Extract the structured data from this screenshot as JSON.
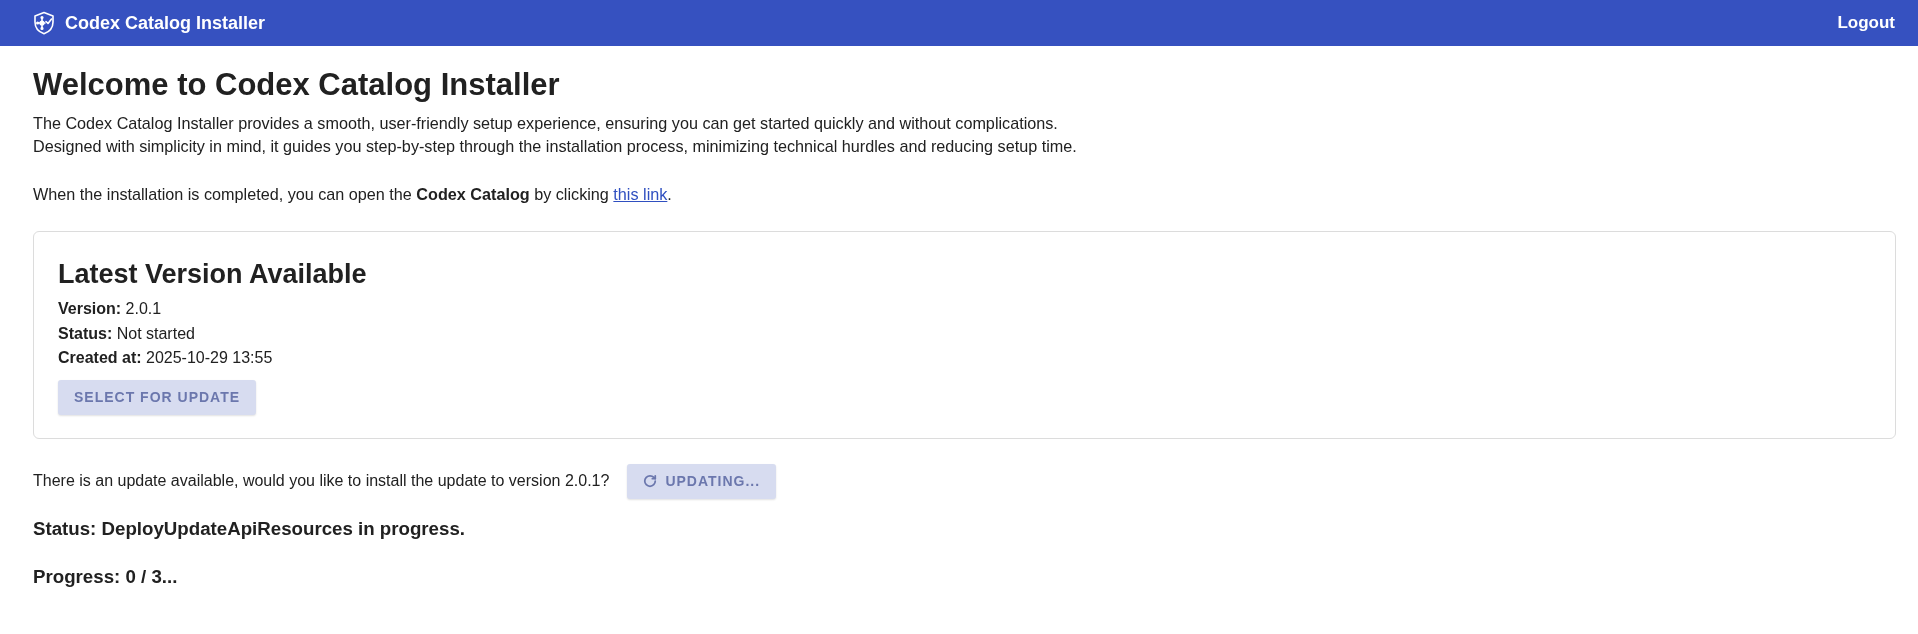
{
  "header": {
    "title": "Codex Catalog Installer",
    "logout": "Logout"
  },
  "intro": {
    "heading": "Welcome to Codex Catalog Installer",
    "lines": [
      "The Codex Catalog Installer provides a smooth, user-friendly setup experience, ensuring you can get started quickly and without complications.",
      "Designed with simplicity in mind, it guides you step-by-step through the installation process, minimizing technical hurdles and reducing setup time."
    ],
    "notice": {
      "before": "When the installation is completed, you can open the **Codex Catalog** by clicking ",
      "link": "this link",
      "after": "."
    }
  },
  "card": {
    "title": "Latest Version Available",
    "fields": [
      "**Version:** 2.0.1",
      "**Status:** Not started",
      "**Created at:** 2025-10-29 13:55"
    ],
    "button": {
      "label": "SELECT FOR UPDATE",
      "disabled": true,
      "busy": false
    }
  },
  "update": {
    "question": "There is an update available, would you like to install the update to version 2.0.1?",
    "button": {
      "label": "UPDATING...",
      "disabled": true,
      "busy": true
    }
  },
  "status": "Status: DeployUpdateApiResources in progress.",
  "progress": "Progress: 0 / 3..."
}
